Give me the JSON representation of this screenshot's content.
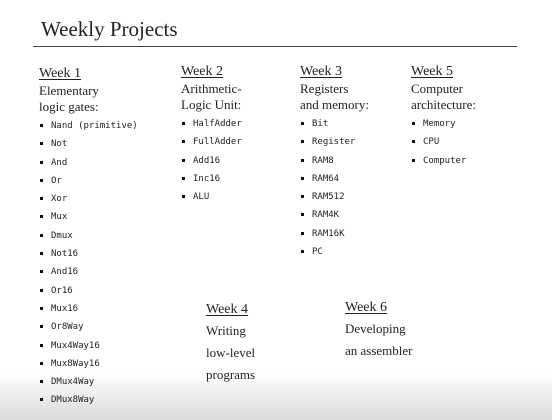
{
  "title": "Weekly Projects",
  "colors": {
    "background": "#ffffff",
    "text": "#222222",
    "rule": "#444444"
  },
  "week1": {
    "heading": "Week 1",
    "desc": [
      "Elementary",
      "logic gates:"
    ],
    "items": [
      "Nand (primitive)",
      "Not",
      "And",
      "Or",
      "Xor",
      "Mux",
      "Dmux",
      "Not16",
      "And16",
      "Or16",
      "Mux16",
      "Or8Way",
      "Mux4Way16",
      "Mux8Way16",
      "DMux4Way",
      "DMux8Way"
    ]
  },
  "week2": {
    "heading": "Week 2",
    "desc": [
      "Arithmetic-",
      "Logic Unit:"
    ],
    "items": [
      "HalfAdder",
      "FullAdder",
      "Add16",
      "Inc16",
      "ALU"
    ]
  },
  "week3": {
    "heading": "Week 3",
    "desc": [
      "Registers",
      "and memory:"
    ],
    "items": [
      "Bit",
      "Register",
      "RAM8",
      "RAM64",
      "RAM512",
      "RAM4K",
      "RAM16K",
      "PC"
    ]
  },
  "week5": {
    "heading": "Week 5",
    "desc": [
      "Computer",
      "architecture:"
    ],
    "items": [
      "Memory",
      "CPU",
      "Computer"
    ]
  },
  "week4": {
    "heading": "Week 4",
    "desc": [
      "Writing",
      "low-level",
      "programs"
    ]
  },
  "week6": {
    "heading": "Week 6",
    "desc": [
      "Developing",
      "an assembler"
    ]
  }
}
